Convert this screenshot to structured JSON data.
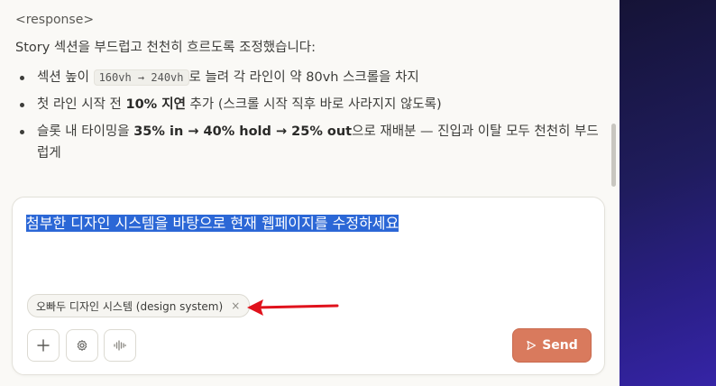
{
  "message": {
    "tag": "<response>",
    "intro": "Story 섹션을 부드럽고 천천히 흐르도록 조정했습니다:",
    "bullets": [
      {
        "before": "섹션 높이 ",
        "code": "160vh → 240vh",
        "after": "로 늘려 각 라인이 약 80vh 스크롤을 차지"
      },
      {
        "before": "첫 라인 시작 전 ",
        "bold": "10% 지연",
        "after": " 추가 (스크롤 시작 직후 바로 사라지지 않도록)"
      },
      {
        "before": "슬롯 내 타이밍을 ",
        "bold": "35% in → 40% hold → 25% out",
        "after": "으로 재배분 — 진입과 이탈 모두 천천히 부드럽게"
      }
    ]
  },
  "composer": {
    "input_text": "첨부한 디자인 시스템을 바탕으로 현재 웹페이지를 수정하세요",
    "attachment_chip": {
      "label": "오빠두 디자인 시스템 (design system)",
      "remove_glyph": "×"
    },
    "send_label": "Send",
    "tools": [
      "plus-icon",
      "settings-icon",
      "audio-waveform-icon"
    ]
  },
  "colors": {
    "accent": "#d97a5d",
    "selection": "#2b67d6",
    "annotation_arrow": "#e0121c",
    "side_panel": "#2a1f86"
  }
}
